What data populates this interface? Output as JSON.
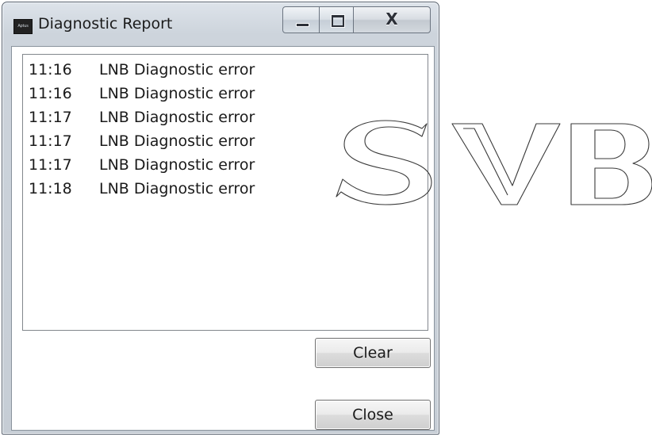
{
  "window": {
    "title": "Diagnostic Report",
    "app_icon_text": "Aptus"
  },
  "caption_buttons": {
    "close_glyph": "X"
  },
  "log": {
    "rows": [
      {
        "time": "11:16",
        "message": "LNB Diagnostic error"
      },
      {
        "time": "11:16",
        "message": "LNB Diagnostic error"
      },
      {
        "time": "11:17",
        "message": "LNB Diagnostic error"
      },
      {
        "time": "11:17",
        "message": "LNB Diagnostic error"
      },
      {
        "time": "11:17",
        "message": "LNB Diagnostic error"
      },
      {
        "time": "11:18",
        "message": "LNB Diagnostic error"
      }
    ]
  },
  "buttons": {
    "clear_label": "Clear",
    "close_label": "Close"
  },
  "watermark": {
    "text": "SVB"
  }
}
